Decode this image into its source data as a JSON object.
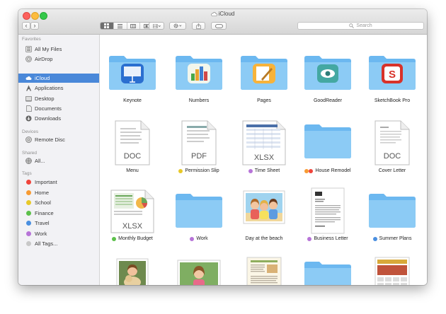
{
  "window": {
    "title": "iCloud"
  },
  "toolbar": {
    "back_label": "‹",
    "forward_label": "›",
    "search_placeholder": "Search"
  },
  "sidebar": {
    "favorites_header": "Favorites",
    "favorites": [
      {
        "label": "All My Files",
        "icon": "all-files-icon"
      },
      {
        "label": "AirDrop",
        "icon": "airdrop-icon"
      },
      {
        "label": "iCloud",
        "icon": "cloud-icon",
        "selected": true
      },
      {
        "label": "Applications",
        "icon": "applications-icon"
      },
      {
        "label": "Desktop",
        "icon": "desktop-icon"
      },
      {
        "label": "Documents",
        "icon": "documents-icon"
      },
      {
        "label": "Downloads",
        "icon": "downloads-icon"
      }
    ],
    "devices_header": "Devices",
    "devices": [
      {
        "label": "Remote Disc",
        "icon": "disc-icon"
      }
    ],
    "shared_header": "Shared",
    "shared": [
      {
        "label": "All...",
        "icon": "network-icon"
      }
    ],
    "tags_header": "Tags",
    "tags": [
      {
        "label": "Important",
        "color": "#f0443b"
      },
      {
        "label": "Home",
        "color": "#f79a32"
      },
      {
        "label": "School",
        "color": "#e8c828"
      },
      {
        "label": "Finance",
        "color": "#5cc04a"
      },
      {
        "label": "Travel",
        "color": "#4a8fe0"
      },
      {
        "label": "Work",
        "color": "#b774d8"
      },
      {
        "label": "All Tags...",
        "color": "#c8c8c8"
      }
    ]
  },
  "files": [
    {
      "label": "Keynote",
      "kind": "app-folder",
      "app": "keynote-icon",
      "tags": []
    },
    {
      "label": "Numbers",
      "kind": "app-folder",
      "app": "numbers-icon",
      "tags": []
    },
    {
      "label": "Pages",
      "kind": "app-folder",
      "app": "pages-icon",
      "tags": []
    },
    {
      "label": "GoodReader",
      "kind": "app-folder",
      "app": "goodreader-icon",
      "tags": []
    },
    {
      "label": "SketchBook Pro",
      "kind": "app-folder",
      "app": "sketchbook-icon",
      "tags": []
    },
    {
      "label": "Menu",
      "kind": "doc",
      "doc_type": "DOC",
      "tags": []
    },
    {
      "label": "Permission Slip",
      "kind": "doc",
      "doc_type": "PDF",
      "tags": [
        "#e8c828"
      ]
    },
    {
      "label": "Time Sheet",
      "kind": "spreadsheet",
      "doc_type": "XLSX",
      "tags": [
        "#b774d8"
      ]
    },
    {
      "label": "House Remodel",
      "kind": "folder",
      "tags": [
        "#f79a32",
        "#f0443b"
      ]
    },
    {
      "label": "Cover Letter",
      "kind": "doc",
      "doc_type": "DOC",
      "tags": []
    },
    {
      "label": "Monthly Budget",
      "kind": "spreadsheet",
      "doc_type": "XLSX",
      "tags": [
        "#5cc04a"
      ]
    },
    {
      "label": "Work",
      "kind": "folder",
      "tags": [
        "#b774d8"
      ]
    },
    {
      "label": "Day at the beach",
      "kind": "photo",
      "tags": []
    },
    {
      "label": "Business Letter",
      "kind": "letter",
      "tags": [
        "#b774d8"
      ]
    },
    {
      "label": "Summer Plans",
      "kind": "folder",
      "tags": [
        "#4a8fe0"
      ]
    },
    {
      "label": "",
      "kind": "photo-dog",
      "tags": []
    },
    {
      "label": "",
      "kind": "photo-girl",
      "tags": []
    },
    {
      "label": "",
      "kind": "recipe",
      "tags": []
    },
    {
      "label": "",
      "kind": "folder",
      "tags": []
    },
    {
      "label": "",
      "kind": "calendar",
      "tags": []
    }
  ],
  "colors": {
    "folder": "#6cb8f0",
    "folder_top": "#8ccbf5",
    "selection": "#4a88d9"
  }
}
